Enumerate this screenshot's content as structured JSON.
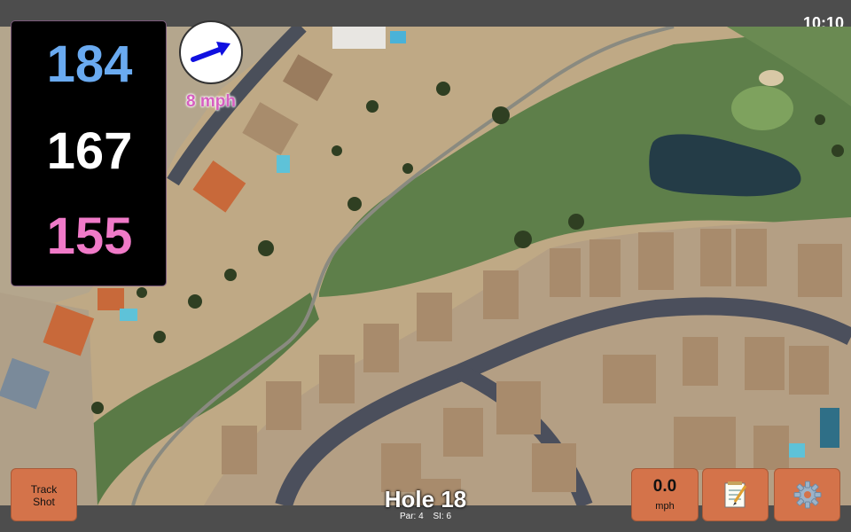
{
  "status": {
    "time": "10:10"
  },
  "distances": {
    "back": "184",
    "middle": "167",
    "front": "155"
  },
  "wind": {
    "speed_label": "8 mph",
    "icon": "wind-arrow-icon",
    "color": "#d65fc0"
  },
  "buttons": {
    "track_shot": "Track\nShot",
    "speed_value": "0.0",
    "speed_unit": "mph",
    "notes_icon": "notepad-icon",
    "settings_icon": "gear-icon",
    "accent": "#d4734a"
  },
  "hole": {
    "title": "Hole 18",
    "par": "Par: 4",
    "si": "SI: 6"
  },
  "colors": {
    "back": "#6aaaf0",
    "middle": "#ffffff",
    "front": "#f07ac8"
  }
}
